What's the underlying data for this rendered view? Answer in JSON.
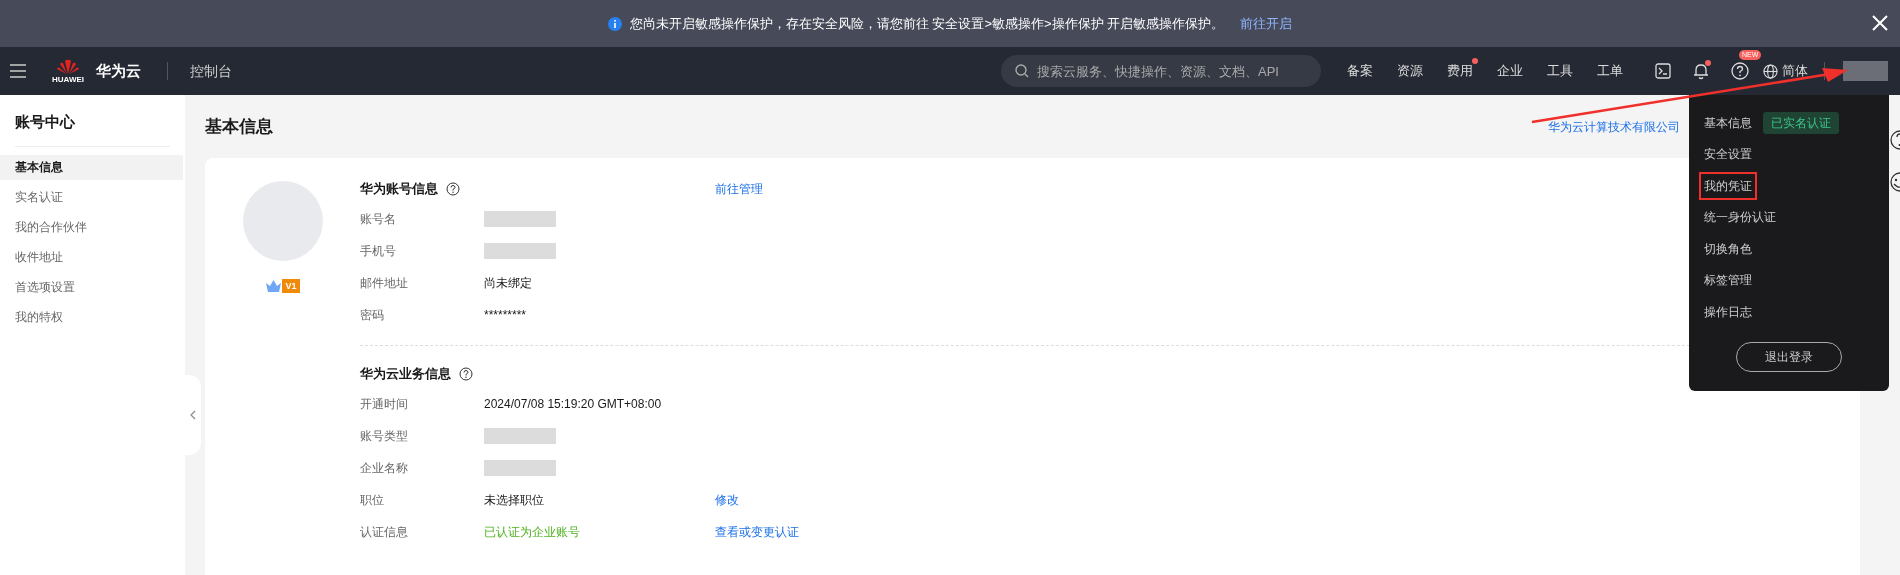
{
  "banner": {
    "message": "您尚未开启敏感操作保护，存在安全风险，请您前往 安全设置>敏感操作>操作保护 开启敏感操作保护。",
    "link": "前往开启"
  },
  "header": {
    "logo_text": "HUAWEI",
    "brand": "华为云",
    "console": "控制台",
    "search": {
      "placeholder": "搜索云服务、快捷操作、资源、文档、API"
    },
    "nav": [
      {
        "label": "备案",
        "dot": false
      },
      {
        "label": "资源",
        "dot": false
      },
      {
        "label": "费用",
        "dot": true
      },
      {
        "label": "企业",
        "dot": false
      },
      {
        "label": "工具",
        "dot": false
      },
      {
        "label": "工单",
        "dot": false
      }
    ],
    "icons": [
      {
        "kind": "terminal",
        "dot": false
      },
      {
        "kind": "bell",
        "dot": true
      },
      {
        "kind": "help",
        "dot": false,
        "badge": "NEW"
      }
    ],
    "language": "简体"
  },
  "sidebar": {
    "title": "账号中心",
    "items": [
      {
        "label": "基本信息",
        "selected": true
      },
      {
        "label": "实名认证",
        "selected": false
      },
      {
        "label": "我的合作伙伴",
        "selected": false
      },
      {
        "label": "收件地址",
        "selected": false
      },
      {
        "label": "首选项设置",
        "selected": false
      },
      {
        "label": "我的特权",
        "selected": false
      }
    ]
  },
  "page_title": "基本信息",
  "company_link": "华为云计算技术有限公司",
  "profile": {
    "level": "V1"
  },
  "sections": [
    {
      "title": "华为账号信息",
      "link": "前往管理",
      "rows": [
        {
          "label": "账号名",
          "kind": "blurred"
        },
        {
          "label": "手机号",
          "kind": "blurred"
        },
        {
          "label": "邮件地址",
          "kind": "text",
          "value": "尚未绑定"
        },
        {
          "label": "密码",
          "kind": "text",
          "value": "*********"
        }
      ]
    },
    {
      "title": "华为云业务信息",
      "rows": [
        {
          "label": "开通时间",
          "kind": "text",
          "value": "2024/07/08 15:19:20 GMT+08:00"
        },
        {
          "label": "账号类型",
          "kind": "blurred"
        },
        {
          "label": "企业名称",
          "kind": "blurred"
        },
        {
          "label": "职位",
          "kind": "text",
          "value": "未选择职位",
          "action": "修改"
        },
        {
          "label": "认证信息",
          "kind": "status",
          "value": "已认证为企业账号",
          "action": "查看或变更认证"
        }
      ]
    }
  ],
  "user_menu": {
    "items": [
      {
        "label": "基本信息",
        "badge": "已实名认证",
        "highlighted": false
      },
      {
        "label": "安全设置",
        "highlighted": false
      },
      {
        "label": "我的凭证",
        "highlighted": true
      },
      {
        "label": "统一身份认证",
        "highlighted": false
      },
      {
        "label": "切换角色",
        "highlighted": false
      },
      {
        "label": "标签管理",
        "highlighted": false
      },
      {
        "label": "操作日志",
        "highlighted": false
      }
    ],
    "logout": "退出登录"
  }
}
